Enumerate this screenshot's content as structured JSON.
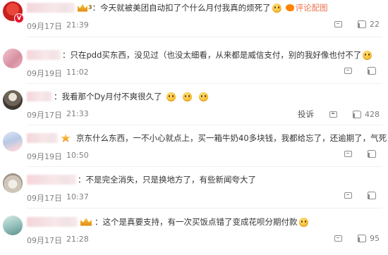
{
  "colors": {
    "link": "#eb7350",
    "meta": "#808080",
    "icon": "#8c8c8c"
  },
  "comments": [
    {
      "avatar_kind": "weibo-red-avatar",
      "text": "：今天就被美团自动扣了个什么月付我真的烦死了",
      "lvl": "3",
      "link": "评论配图",
      "date": "09月17日",
      "time": "21:39",
      "report": "",
      "likes": "22"
    },
    {
      "avatar_kind": "pink-avatar",
      "text": "：只在pdd买东西，没见过（也没太细看，从来都是威信支付，别的我好像也付不了",
      "date": "09月19日",
      "time": "11:02",
      "report": "",
      "likes": ""
    },
    {
      "avatar_kind": "gray-avatar",
      "text": "：我看那个Dy月付不爽很久了",
      "date": "09月17日",
      "time": "21:33",
      "report": "投诉",
      "likes": "428"
    },
    {
      "avatar_kind": "blue-avatar",
      "text": "京东什么东西，一不小心就点上，买一箱牛奶40多块钱，我都给忘了，还逾期了，气死",
      "date": "09月19日",
      "time": "10:50",
      "report": "",
      "likes": ""
    },
    {
      "avatar_kind": "cat-avatar",
      "text": "：不是完全消失，只是换地方了，有些新闻夸大了",
      "date": "09月17日",
      "time": "10:37",
      "report": "",
      "likes": ""
    },
    {
      "avatar_kind": "teal-avatar",
      "text": "：这个是真要支持，有一次买饭点错了变成花呗分期付款",
      "date": "09月17日",
      "time": "21:28",
      "report": "",
      "likes": "95"
    }
  ]
}
